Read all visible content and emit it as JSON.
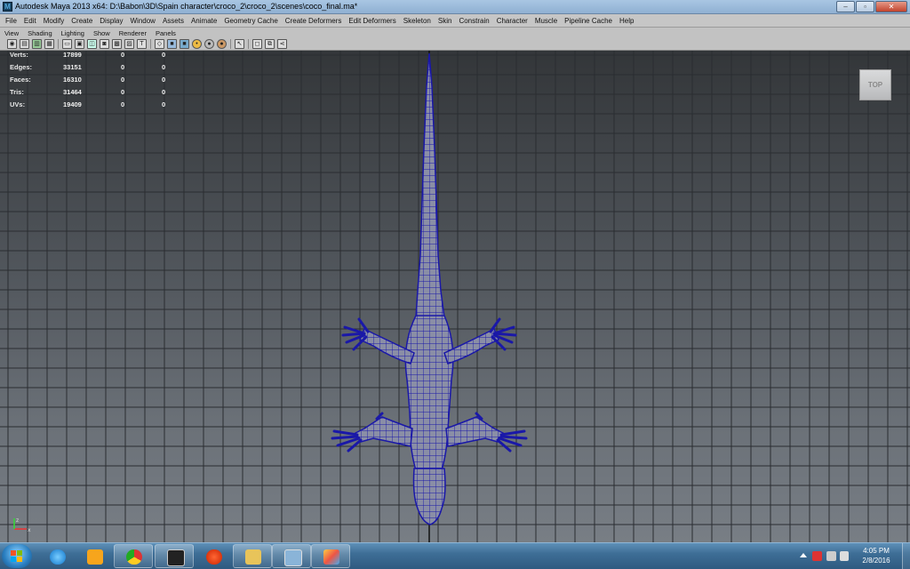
{
  "window": {
    "title": "Autodesk Maya 2013 x64: D:\\Babon\\3D\\Spain character\\croco_2\\croco_2\\scenes\\coco_final.ma*",
    "minimize": "–",
    "maximize": "▫",
    "close": "✕"
  },
  "menubar": {
    "items": [
      "File",
      "Edit",
      "Modify",
      "Create",
      "Display",
      "Window",
      "Assets",
      "Animate",
      "Geometry Cache",
      "Create Deformers",
      "Edit Deformers",
      "Skeleton",
      "Skin",
      "Constrain",
      "Character",
      "Muscle",
      "Pipeline Cache",
      "Help"
    ]
  },
  "panel_menu": {
    "items": [
      "View",
      "Shading",
      "Lighting",
      "Show",
      "Renderer",
      "Panels"
    ]
  },
  "toolbar_icons": [
    "camera-icon",
    "bookmark-icon",
    "image-plane-icon",
    "grid-icon",
    "film-gate-icon",
    "resolution-gate-icon",
    "wireframe-icon",
    "smooth-shade-icon",
    "textured-icon",
    "lights-icon",
    "shadows-icon",
    "xray-icon",
    "isolate-icon"
  ],
  "hud": {
    "rows": [
      {
        "label": "Verts:",
        "v1": "17899",
        "v2": "0",
        "v3": "0"
      },
      {
        "label": "Edges:",
        "v1": "33151",
        "v2": "0",
        "v3": "0"
      },
      {
        "label": "Faces:",
        "v1": "16310",
        "v2": "0",
        "v3": "0"
      },
      {
        "label": "Tris:",
        "v1": "31464",
        "v2": "0",
        "v3": "0"
      },
      {
        "label": "UVs:",
        "v1": "19409",
        "v2": "0",
        "v3": "0"
      }
    ]
  },
  "viewcube": {
    "label": "TOP"
  },
  "colors": {
    "wireframe": "#1a18a8",
    "grid": "#2a2d31",
    "viewport_top": "#333639",
    "viewport_bottom": "#787e85"
  },
  "taskbar": {
    "apps": [
      "windows-explorer-icon",
      "internet-explorer-icon",
      "media-player-icon",
      "chrome-icon",
      "maya-icon",
      "avast-icon",
      "file-explorer-icon",
      "screen-capture-icon",
      "paint-icon"
    ],
    "clock": {
      "time": "4:05 PM",
      "date": "2/8/2016"
    }
  }
}
